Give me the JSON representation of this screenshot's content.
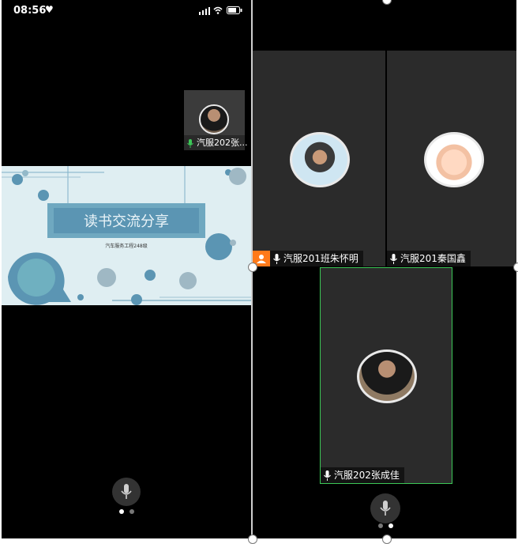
{
  "status_bar": {
    "time": "08:56",
    "signal": "signal-bars-icon",
    "wifi": "wifi-icon",
    "battery": "battery-icon"
  },
  "left": {
    "self_video": {
      "name": "汽服202张..."
    },
    "slide": {
      "title": "读书交流分享",
      "subtitle": "汽车服务工程248级"
    },
    "pager": {
      "active": 0,
      "count": 2
    }
  },
  "right": {
    "tiles": [
      {
        "name": "汽服201班朱怀明",
        "host": true
      },
      {
        "name": "汽服201秦国鑫",
        "host": false
      }
    ],
    "speaker": {
      "name": "汽服202张成佳"
    },
    "pager": {
      "active": 1,
      "count": 2
    }
  },
  "colors": {
    "accent_green": "#3cc857",
    "host_orange": "#ff7a1a",
    "tile_bg": "#2b2b2b",
    "slide_teal": "#5b95b3"
  }
}
